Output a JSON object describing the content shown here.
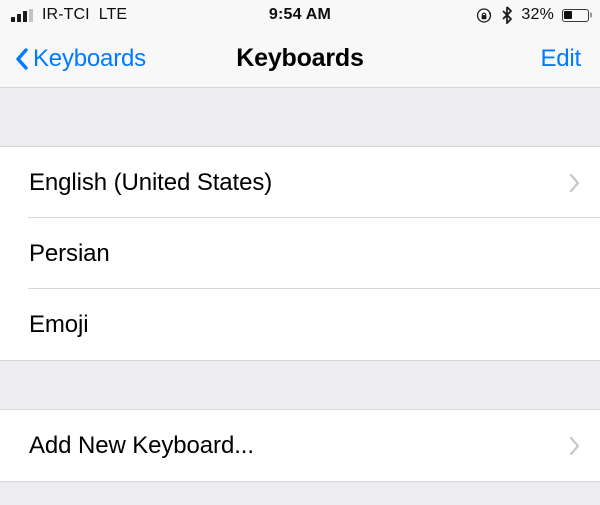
{
  "status_bar": {
    "carrier": "IR-TCI",
    "network": "LTE",
    "time": "9:54 AM",
    "battery_percent": "32%",
    "battery_level": 33,
    "signal_bars_filled": 3,
    "signal_bars_total": 4,
    "icons": {
      "signal": "signal-bars-icon",
      "rotation_lock": "rotation-lock-icon",
      "bluetooth": "bluetooth-icon",
      "battery": "battery-icon"
    }
  },
  "nav_bar": {
    "back_label": "Keyboards",
    "back_icon": "chevron-left-icon",
    "title": "Keyboards",
    "edit_label": "Edit",
    "accent_color": "#007AFF"
  },
  "sections": [
    {
      "name": "active-keyboards",
      "rows": [
        {
          "label": "English (United States)",
          "has_chevron": true
        },
        {
          "label": "Persian",
          "has_chevron": false
        },
        {
          "label": "Emoji",
          "has_chevron": false
        }
      ]
    },
    {
      "name": "add-keyboard",
      "rows": [
        {
          "label": "Add New Keyboard...",
          "has_chevron": true
        }
      ]
    }
  ],
  "colors": {
    "background": "#EDECF1",
    "cell": "#FFFFFF",
    "separator": "#D6D5DA",
    "text": "#000000",
    "chevron": "#C7C7CC",
    "status_bar_bg": "#F8F8F8"
  }
}
